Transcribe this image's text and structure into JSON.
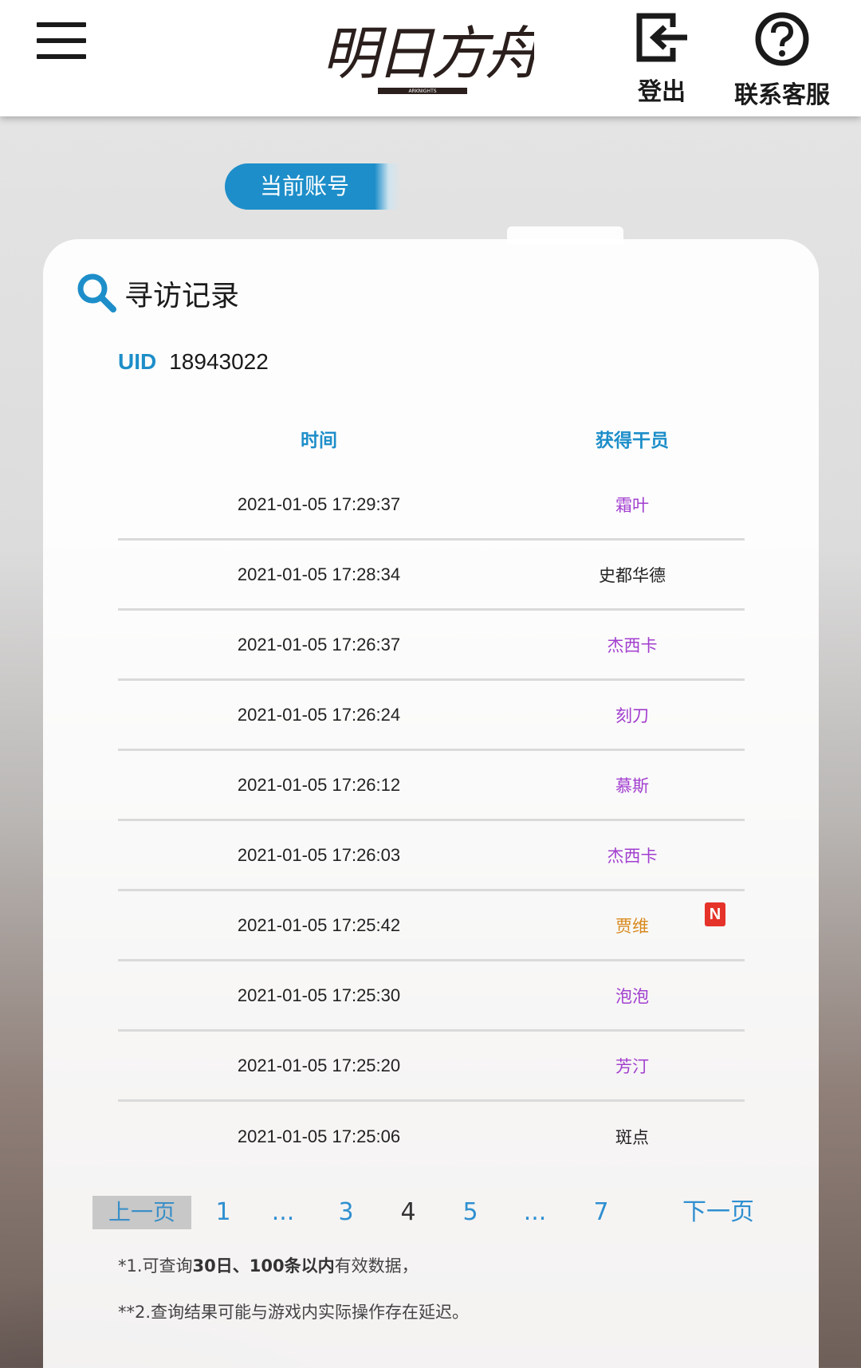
{
  "header": {
    "logo_text": "明日方舟",
    "logo_sub": "ARKNIGHTS",
    "logout_label": "登出",
    "support_label": "联系客服"
  },
  "account": {
    "label": "当前账号"
  },
  "card": {
    "title": "寻访记录",
    "uid_label": "UID",
    "uid_value": "18943022"
  },
  "table": {
    "headers": {
      "time": "时间",
      "operator": "获得干员"
    },
    "rows": [
      {
        "time": "2021-01-05 17:29:37",
        "operator": "霜叶",
        "color": "#a23fcf",
        "new": false
      },
      {
        "time": "2021-01-05 17:28:34",
        "operator": "史都华德",
        "color": "#222222",
        "new": false
      },
      {
        "time": "2021-01-05 17:26:37",
        "operator": "杰西卡",
        "color": "#a23fcf",
        "new": false
      },
      {
        "time": "2021-01-05 17:26:24",
        "operator": "刻刀",
        "color": "#a23fcf",
        "new": false
      },
      {
        "time": "2021-01-05 17:26:12",
        "operator": "慕斯",
        "color": "#a23fcf",
        "new": false
      },
      {
        "time": "2021-01-05 17:26:03",
        "operator": "杰西卡",
        "color": "#a23fcf",
        "new": false
      },
      {
        "time": "2021-01-05 17:25:42",
        "operator": "贾维",
        "color": "#d9891c",
        "new": true
      },
      {
        "time": "2021-01-05 17:25:30",
        "operator": "泡泡",
        "color": "#a23fcf",
        "new": false
      },
      {
        "time": "2021-01-05 17:25:20",
        "operator": "芳汀",
        "color": "#a23fcf",
        "new": false
      },
      {
        "time": "2021-01-05 17:25:06",
        "operator": "斑点",
        "color": "#222222",
        "new": false
      }
    ],
    "new_badge": "N"
  },
  "pager": {
    "prev": "上一页",
    "items": [
      "1",
      "...",
      "3",
      "4",
      "5",
      "...",
      "7"
    ],
    "current": "4",
    "next": "下一页"
  },
  "notes": {
    "line1_prefix": "*1.可查询",
    "line1_bold": "30日、100条以内",
    "line1_suffix": "有效数据，",
    "line2": "**2.查询结果可能与游戏内实际操作存在延迟。"
  },
  "colors": {
    "accent": "#1d8ec9",
    "rarity_4": "#a23fcf",
    "rarity_5": "#d9891c",
    "new_badge": "#e5332a"
  }
}
